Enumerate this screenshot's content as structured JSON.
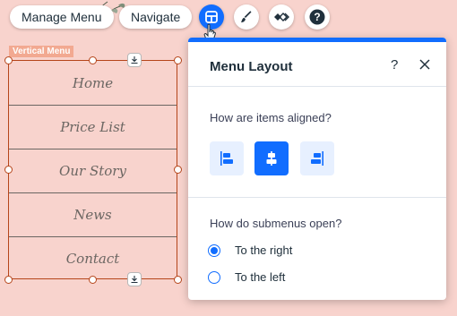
{
  "toolbar": {
    "manage_menu_label": "Manage Menu",
    "navigate_label": "Navigate",
    "icons": [
      "layout-icon",
      "paint-brush-icon",
      "animation-icon",
      "help-icon"
    ],
    "accent": "#116dff"
  },
  "element": {
    "tag": "Vertical Menu",
    "items": [
      {
        "label": "Home"
      },
      {
        "label": "Price List"
      },
      {
        "label": "Our Story"
      },
      {
        "label": "News"
      },
      {
        "label": "Contact"
      }
    ],
    "selection_color": "#b5451a"
  },
  "panel": {
    "title": "Menu Layout",
    "help": "?",
    "alignment": {
      "question": "How are items aligned?",
      "options": [
        "align-left",
        "align-center",
        "align-right"
      ],
      "selected": "align-center"
    },
    "submenus": {
      "question": "How do submenus open?",
      "options": [
        {
          "label": "To the right",
          "selected": true
        },
        {
          "label": "To the left",
          "selected": false
        }
      ]
    }
  }
}
